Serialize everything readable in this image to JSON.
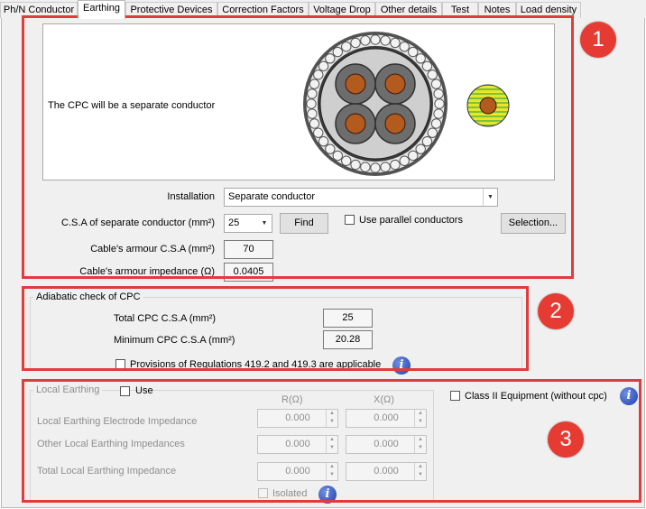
{
  "tabs": [
    {
      "label": "Ph/N Conductor"
    },
    {
      "label": "Earthing"
    },
    {
      "label": "Protective Devices"
    },
    {
      "label": "Correction Factors"
    },
    {
      "label": "Voltage Drop"
    },
    {
      "label": "Other details"
    },
    {
      "label": "Test"
    },
    {
      "label": "Notes"
    },
    {
      "label": "Load density"
    }
  ],
  "active_tab": "Earthing",
  "section1": {
    "badge": "1",
    "cpc_text": "The CPC will be a separate conductor",
    "installation_label": "Installation",
    "installation_value": "Separate conductor",
    "csa_label": "C.S.A of separate conductor (mm²)",
    "csa_value": "25",
    "find_label": "Find",
    "parallel_label": "Use parallel conductors",
    "selection_label": "Selection...",
    "armour_csa_label": "Cable's armour C.S.A (mm²)",
    "armour_csa_value": "70",
    "armour_imp_label": "Cable's armour impedance (Ω)",
    "armour_imp_value": "0.0405"
  },
  "section2": {
    "badge": "2",
    "title": "Adiabatic check of CPC",
    "total_label": "Total CPC C.S.A (mm²)",
    "total_value": "25",
    "min_label": "Minimum CPC C.S.A (mm²)",
    "min_value": "20.28",
    "provisions_label": "Provisions of Regulations 419.2 and 419.3 are applicable"
  },
  "section3": {
    "badge": "3",
    "title": "Local Earthing",
    "use_label": "Use",
    "r_header": "R(Ω)",
    "x_header": "X(Ω)",
    "rows": [
      {
        "label": "Local Earthing Electrode Impedance",
        "r": "0.000",
        "x": "0.000"
      },
      {
        "label": "Other Local Earthing Impedances",
        "r": "0.000",
        "x": "0.000"
      },
      {
        "label": "Total Local Earthing Impedance",
        "r": "0.000",
        "x": "0.000"
      }
    ],
    "isolated_label": "Isolated",
    "class2_label": "Class II Equipment (without cpc)"
  },
  "colors": {
    "highlight": "#e03c3c",
    "badge": "#e53b32",
    "conductor_core": "#b35a1f",
    "cpc_yellow": "#e6e62a",
    "cpc_green": "#6fbf3a"
  }
}
